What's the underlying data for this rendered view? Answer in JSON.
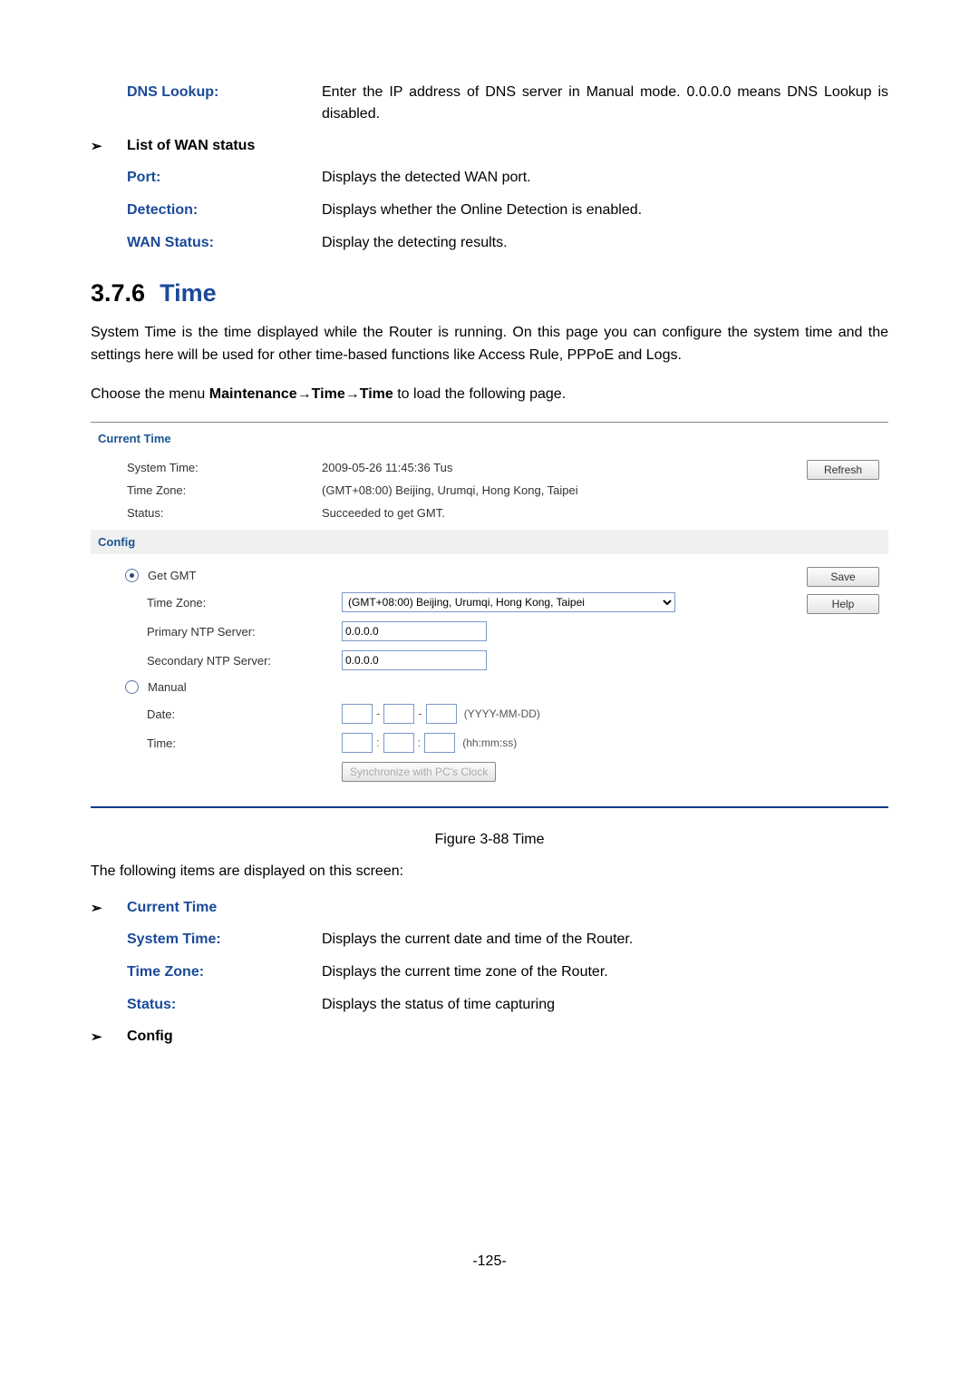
{
  "defs_top": {
    "dns_lookup": {
      "label": "DNS Lookup:",
      "value": "Enter the IP address of DNS server in Manual mode. 0.0.0.0 means DNS Lookup is disabled."
    }
  },
  "heading_wan": "List of WAN status",
  "defs_wan": {
    "port": {
      "label": "Port:",
      "value": "Displays the detected WAN port."
    },
    "detection": {
      "label": "Detection:",
      "value": "Displays whether the Online Detection is enabled."
    },
    "wan_status": {
      "label": "WAN Status:",
      "value": "Display the detecting results."
    }
  },
  "section": {
    "num": "3.7.6",
    "title": "Time"
  },
  "para1": "System Time is the time displayed while the Router is running. On this page you can configure the system time and the settings here will be used for other time-based functions like Access Rule, PPPoE and Logs.",
  "para2_pre": "Choose the menu ",
  "para2_bold": "Maintenance→Time→Time",
  "para2_post": " to load the following page.",
  "figure": {
    "current_time_title": "Current Time",
    "system_time_label": "System Time:",
    "system_time_value": "2009-05-26 11:45:36 Tus",
    "time_zone_label": "Time Zone:",
    "time_zone_value": "(GMT+08:00) Beijing, Urumqi, Hong Kong, Taipei",
    "status_label": "Status:",
    "status_value": "Succeeded to get GMT.",
    "refresh_btn": "Refresh",
    "config_title": "Config",
    "get_gmt": "Get GMT",
    "cfg_time_zone_label": "Time Zone:",
    "cfg_time_zone_option": "(GMT+08:00) Beijing, Urumqi, Hong Kong, Taipei",
    "primary_ntp_label": "Primary NTP Server:",
    "primary_ntp_value": "0.0.0.0",
    "secondary_ntp_label": "Secondary NTP Server:",
    "secondary_ntp_value": "0.0.0.0",
    "manual": "Manual",
    "date_label": "Date:",
    "date_hint": "(YYYY-MM-DD)",
    "time_label": "Time:",
    "time_hint": "(hh:mm:ss)",
    "sync_btn": "Synchronize with PC's Clock",
    "save_btn": "Save",
    "help_btn": "Help"
  },
  "figure_caption": "Figure 3-88 Time",
  "items_intro": "The following items are displayed on this screen:",
  "heading_current_time": "Current Time",
  "defs_ct": {
    "system_time": {
      "label": "System Time:",
      "value": "Displays the current date and time of the Router."
    },
    "time_zone": {
      "label": "Time Zone:",
      "value": "Displays the current time zone of the Router."
    },
    "status": {
      "label": "Status:",
      "value": "Displays the status of time capturing"
    }
  },
  "heading_config": "Config",
  "page_number": "-125-"
}
